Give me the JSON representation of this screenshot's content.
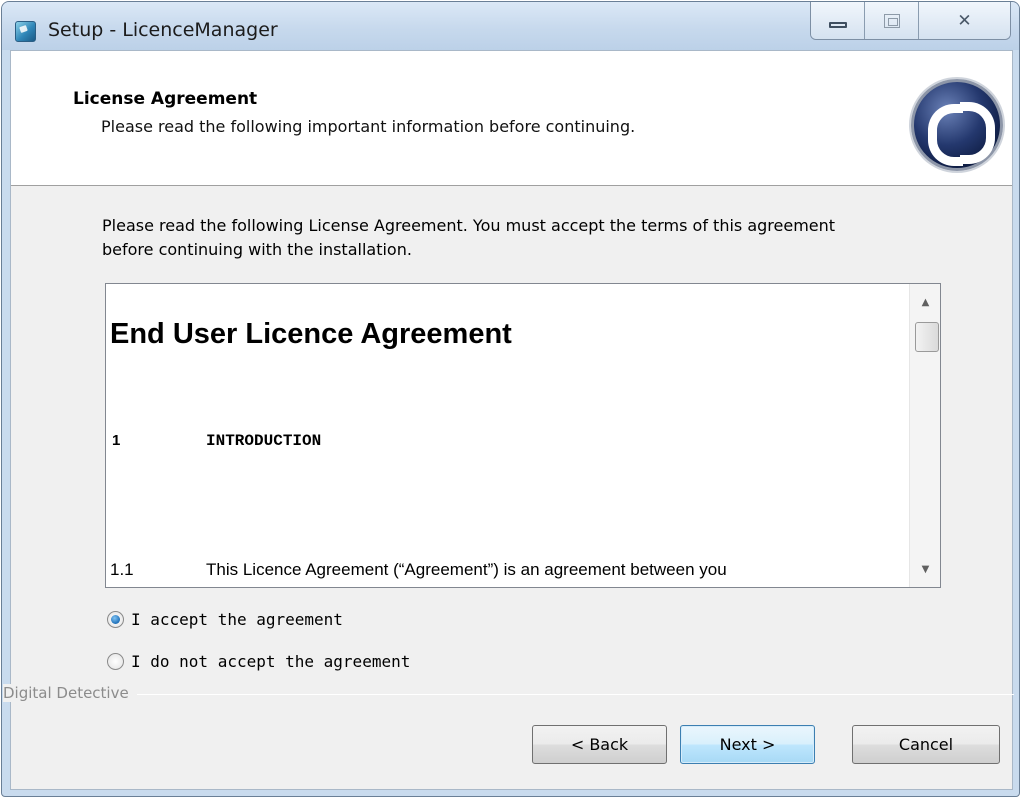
{
  "window": {
    "title": "Setup - LicenceManager",
    "controls": {
      "minimize": "minimize",
      "maximize": "maximize",
      "close": "close"
    }
  },
  "header": {
    "title": "License Agreement",
    "subtitle": "Please read the following important information before continuing.",
    "logo_icon": "digital-detective-logo-icon"
  },
  "intro_text": "Please read the following License Agreement. You must accept the terms of this agreement before continuing with the installation.",
  "license": {
    "heading": "End User Licence Agreement",
    "section_number": "1",
    "section_title": "INTRODUCTION",
    "clause_number": "1.1",
    "clause_text": "This Licence Agreement (“Agreement”) is an agreement between you"
  },
  "options": {
    "accept_label": "I accept the agreement",
    "decline_label": "I do not accept the agreement",
    "selected": "accept"
  },
  "brand": "Digital Detective",
  "buttons": {
    "back": "< Back",
    "next": "Next >",
    "cancel": "Cancel"
  },
  "colors": {
    "titlebar": "#c7d9ed",
    "dialog_bg": "#f0f0f0",
    "default_button_border": "#3c7fb1"
  }
}
